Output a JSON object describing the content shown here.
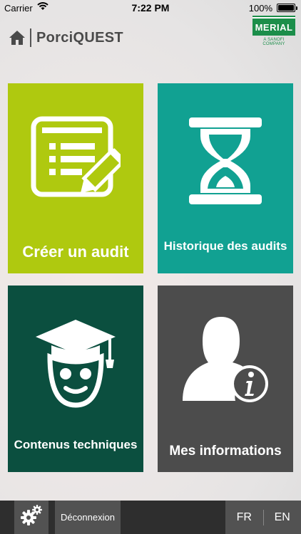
{
  "status_bar": {
    "carrier": "Carrier",
    "time": "7:22 PM",
    "battery": "100%"
  },
  "header": {
    "title": "PorciQUEST"
  },
  "logo": {
    "name": "MERIAL",
    "tagline": "A SANOFI COMPANY"
  },
  "tiles": {
    "create": {
      "label": "Créer un audit",
      "color": "#afc90f",
      "icon": "clipboard-list-icon"
    },
    "history": {
      "label": "Historique des audits",
      "color": "#11a192",
      "icon": "hourglass-icon"
    },
    "contents": {
      "label": "Contenus techniques",
      "color": "#0b4f3f",
      "icon": "graduate-icon"
    },
    "info": {
      "label": "Mes informations",
      "color": "#4c4c4c",
      "icon": "user-info-icon"
    }
  },
  "bottom_bar": {
    "logout_label": "Déconnexion",
    "languages": [
      "FR",
      "EN"
    ]
  }
}
